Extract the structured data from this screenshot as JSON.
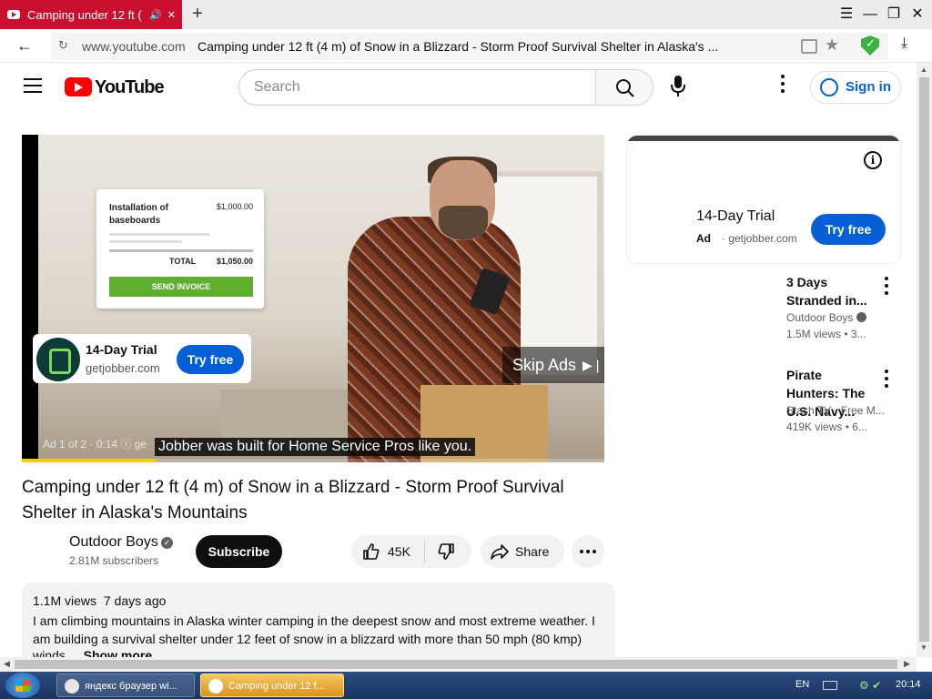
{
  "browser": {
    "tab_title": "Camping under 12 ft (",
    "new_tab_label": "+",
    "url_domain": "www.youtube.com",
    "url_title": "Camping under 12 ft (4 m) of Snow in a Blizzard - Storm Proof Survival Shelter in Alaska's ..."
  },
  "header": {
    "logo_text": "YouTube",
    "search_placeholder": "Search",
    "signin_label": "Sign in"
  },
  "player": {
    "invoice": {
      "item": "Installation of baseboards",
      "item_amount": "$1,000.00",
      "total_label": "TOTAL",
      "total_amount": "$1,050.00",
      "button": "SEND INVOICE"
    },
    "ad_title": "14-Day Trial",
    "ad_domain": "getjobber.com",
    "ad_cta": "Try free",
    "skip_label": "Skip Ads",
    "ad_counter": "Ad 1 of 2 · 0:14  ⓘ  ge",
    "caption": "Jobber was built for Home Service Pros like you.",
    "ad_progress": 0.23
  },
  "video": {
    "title": "Camping under 12 ft (4 m) of Snow in a Blizzard - Storm Proof Survival Shelter in Alaska's Mountains",
    "channel": "Outdoor Boys",
    "subscribers": "2.81M subscribers",
    "subscribe_label": "Subscribe",
    "likes": "45K",
    "share_label": "Share",
    "views": "1.1M views",
    "age": "7 days ago",
    "description": "I am climbing mountains in Alaska winter camping in the deepest snow and most extreme weather. I am building a survival shelter under 12 feet of snow in a blizzard with more than 50 mph (80 kmp)",
    "description_tail": "winds",
    "show_more": "...Show more"
  },
  "sidebar": {
    "ad": {
      "title": "14-Day Trial",
      "label": "Ad",
      "domain": "· getjobber.com",
      "cta": "Try free"
    },
    "recommendations": [
      {
        "title": "3 Days Stranded in...",
        "channel": "Outdoor Boys",
        "verified": true,
        "meta": "1.5M views  • 3..."
      },
      {
        "title": "Pirate Hunters: The U.S. Navy...",
        "channel": "Stash TV - Free M...",
        "verified": false,
        "meta": "419K views  • 6..."
      }
    ]
  },
  "taskbar": {
    "task_1": "яндекс браузер wi...",
    "task_2": "Camping under 12 f...",
    "lang": "EN",
    "clock": "20:14"
  },
  "colors": {
    "tab_red": "#c8102e",
    "yt_red": "#ff0000",
    "accent_blue": "#065fd4",
    "ad_progress_yellow": "#ffcc00"
  }
}
